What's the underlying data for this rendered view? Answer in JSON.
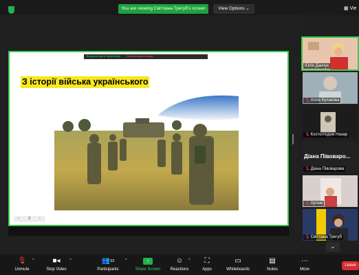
{
  "topbar": {
    "share_banner": "You are viewing Світлана Трегуб's screen",
    "view_options": "View Options",
    "grid_view": "Vie"
  },
  "ppt_toolbar": {
    "item1": "Ви демонструєте презентацію",
    "item2": "Зупинити демонстрацію"
  },
  "slide": {
    "title": "З історії війська українського",
    "nav_prev": "‹",
    "nav_page": "3",
    "nav_next": "›"
  },
  "participants": [
    {
      "name": "Юлія Данчук",
      "muted": false
    },
    {
      "name": "Алла Кулакова",
      "muted": true
    },
    {
      "name": "Костоглодов Назар",
      "muted": true
    },
    {
      "name": "Діана Півоварова",
      "muted": true,
      "display_name": "Діана  Півоваро..."
    },
    {
      "name": "Артем",
      "muted": true
    },
    {
      "name": "Світлана Трегуб",
      "muted": true
    }
  ],
  "controls": {
    "unmute": "Unmute",
    "stop_video": "Stop Video",
    "participants": "Participants",
    "participants_count": "33",
    "share_screen": "Share Screen",
    "reactions": "Reactions",
    "apps": "Apps",
    "whiteboards": "Whiteboards",
    "notes": "Notes",
    "more": "More",
    "leave": "Leave"
  },
  "colors": {
    "accent_green": "#23b14d",
    "leave_red": "#d92e2e",
    "title_highlight": "#f7e81e"
  }
}
